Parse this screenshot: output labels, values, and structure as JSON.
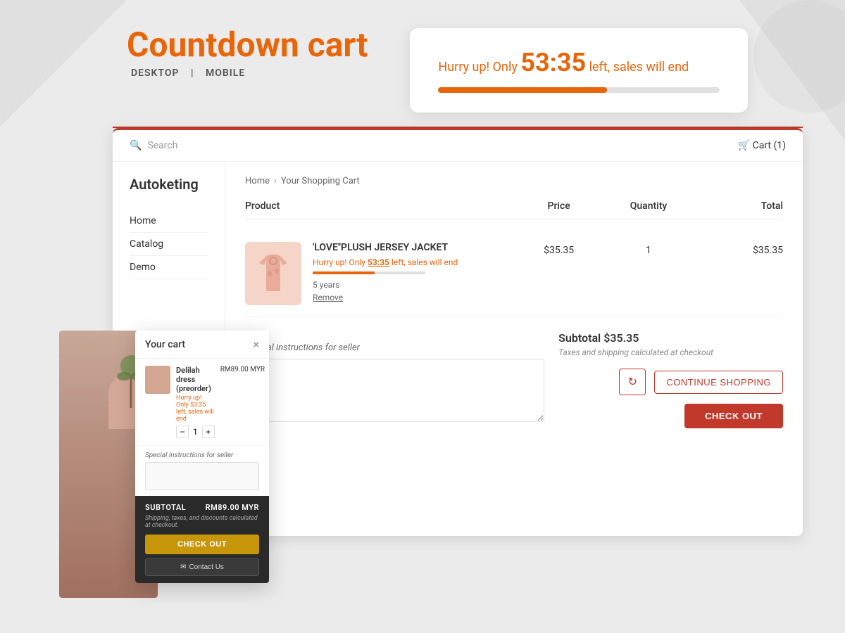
{
  "brand": {
    "title": "Countdown cart",
    "subtitle_desktop": "DESKTOP",
    "subtitle_separator": "|",
    "subtitle_mobile": "MOBILE"
  },
  "countdown_banner": {
    "prefix": "Hurry up! Only",
    "time": "53:35",
    "suffix": "left, sales will end",
    "bar_percent": 60
  },
  "store": {
    "logo": "Autoketing",
    "search_placeholder": "Search",
    "cart_label": "Cart (1)",
    "nav": [
      {
        "label": "Home"
      },
      {
        "label": "Catalog"
      },
      {
        "label": "Demo"
      }
    ]
  },
  "breadcrumb": {
    "home": "Home",
    "separator": "›",
    "current": "Your Shopping Cart"
  },
  "cart_table": {
    "headers": {
      "product": "Product",
      "price": "Price",
      "quantity": "Quantity",
      "total": "Total"
    },
    "items": [
      {
        "name": "'LOVE''PLUSH JERSEY JACKET",
        "countdown_prefix": "Hurry up! Only",
        "countdown_time": "53:35",
        "countdown_suffix": "left, sales will end",
        "variant": "5 years",
        "remove_label": "Remove",
        "price": "$35.35",
        "quantity": "1",
        "total": "$35.35"
      }
    ]
  },
  "special_instructions": {
    "label": "Special instructions for seller",
    "placeholder": ""
  },
  "subtotal": {
    "label": "Subtotal",
    "amount": "$35.35",
    "tax_note": "Taxes and shipping calculated at checkout"
  },
  "buttons": {
    "refresh_icon": "↻",
    "continue_shopping": "CONTINUE SHOPPING",
    "check_out": "CHECK OUT"
  },
  "mobile_cart": {
    "title": "Your cart",
    "close_icon": "×",
    "item": {
      "name": "Delilah dress (preorder)",
      "countdown": "Hurry up! Only 53:35 left, sales will end",
      "qty": "1",
      "price": "RM89.00 MYR"
    },
    "instructions_label": "Special instructions for seller",
    "subtotal_label": "SUBTOTAL",
    "subtotal_amount": "RM89.00 MYR",
    "tax_note": "Shipping, taxes, and discounts calculated at checkout.",
    "checkout_label": "CHECK OUT",
    "contact_label": "Contact Us"
  }
}
